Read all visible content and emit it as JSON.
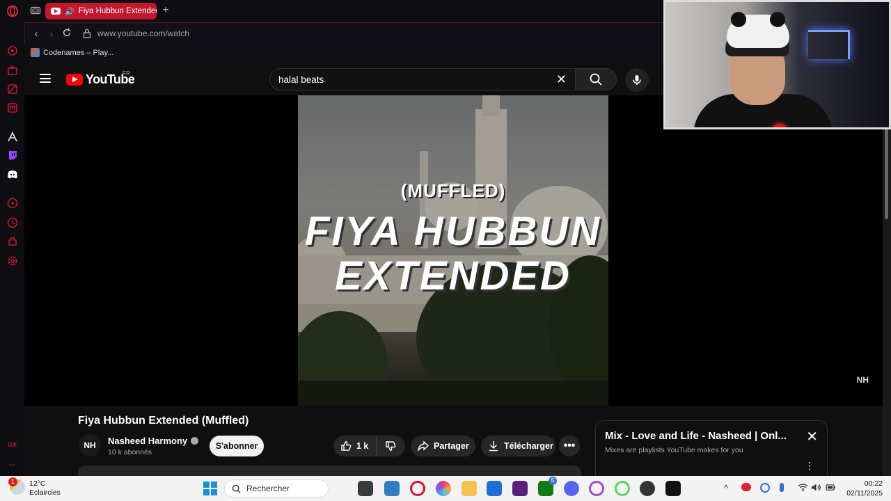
{
  "browser": {
    "tab": {
      "title": "Fiya Hubbun Extended"
    },
    "address": {
      "url": "www.youtube.com/watch"
    },
    "bookmarks": [
      {
        "label": "Codenames – Play..."
      }
    ],
    "sidebar_icons": [
      "opera-logo-icon",
      "aria-icon",
      "cashback-icon",
      "news-icon",
      "mail-icon",
      "arc-icon",
      "twitch-icon",
      "discord-icon",
      "player-icon",
      "history-icon",
      "extensions-icon",
      "settings-icon",
      "gx-icon",
      "more-icon"
    ],
    "sidebar_more": "...",
    "sidebar_gx": "GX"
  },
  "youtube": {
    "logo_text": "YouTube",
    "region": "FR",
    "search": {
      "query": "halal beats"
    },
    "video": {
      "thumb_small": "(MUFFLED)",
      "thumb_line1": "FIYA HUBBUN",
      "thumb_line2": "EXTENDED",
      "watermark": "NH",
      "title": "Fiya Hubbun Extended (Muffled)"
    },
    "channel": {
      "avatar": "NH",
      "name": "Nasheed Harmony",
      "subscribers": "10 k abonnés",
      "subscribe_label": "S'abonner"
    },
    "actions": {
      "likes": "1 k",
      "share": "Partager",
      "download": "Télécharger",
      "more": "•••"
    },
    "mix": {
      "title": "Mix - Love and Life - Nasheed | Onl...",
      "subtitle": "Mixes are playlists YouTube makes for you"
    }
  },
  "taskbar": {
    "weather": {
      "temp": "12°C",
      "condition": "Eclaircies",
      "badge": "1"
    },
    "search_placeholder": "Rechercher",
    "time": "00:22",
    "date": "02/11/2025",
    "xbox_badge": "5"
  },
  "colors": {
    "opera_red": "#c0182f",
    "yt_red": "#ff0000",
    "background": "#0f0f0f"
  }
}
